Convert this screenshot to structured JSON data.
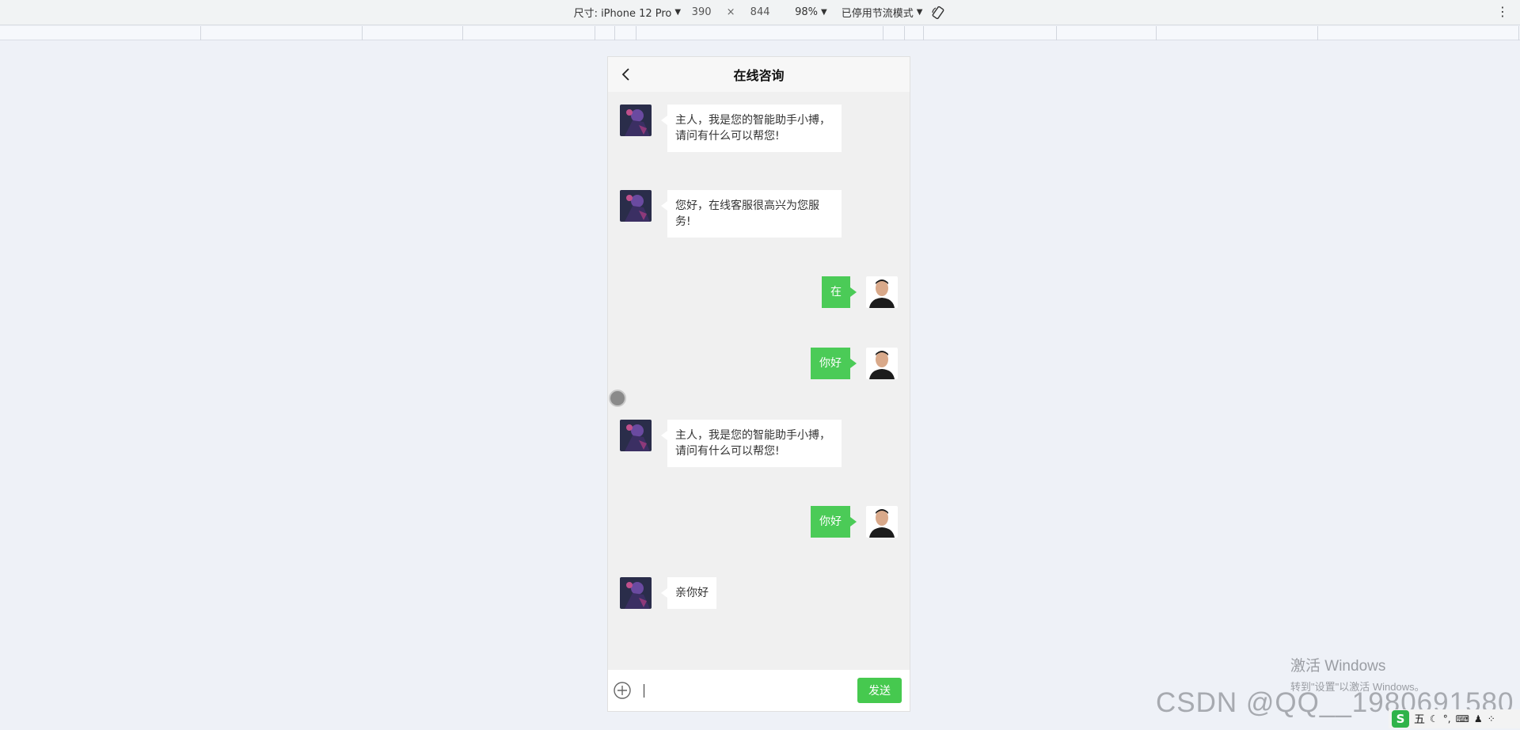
{
  "devtools": {
    "size_label": "尺寸: iPhone 12 Pro",
    "width": "390",
    "times": "×",
    "height": "844",
    "zoom": "98%",
    "throttle": "已停用节流模式",
    "more_icon": "⋮"
  },
  "chat": {
    "title": "在线咨询",
    "messages": [
      {
        "side": "left",
        "text": "主人，我是您的智能助手小搏，请问有什么可以帮您!"
      },
      {
        "side": "left",
        "text": "您好，在线客服很高兴为您服务!"
      },
      {
        "side": "right",
        "text": "在"
      },
      {
        "side": "right",
        "text": "你好"
      },
      {
        "side": "left",
        "text": "主人，我是您的智能助手小搏，请问有什么可以帮您!"
      },
      {
        "side": "right",
        "text": "你好"
      },
      {
        "side": "left",
        "text": "亲你好"
      }
    ],
    "input_value": "",
    "send_label": "发送"
  },
  "colors": {
    "accent_green": "#4bcb57",
    "chat_bg": "#f0f0f0"
  },
  "watermark": {
    "activate_title": "激活 Windows",
    "activate_sub": "转到\"设置\"以激活 Windows。",
    "csdn": "CSDN @QQ__1980691580"
  },
  "ime": {
    "logo": "S",
    "mode": "五"
  }
}
